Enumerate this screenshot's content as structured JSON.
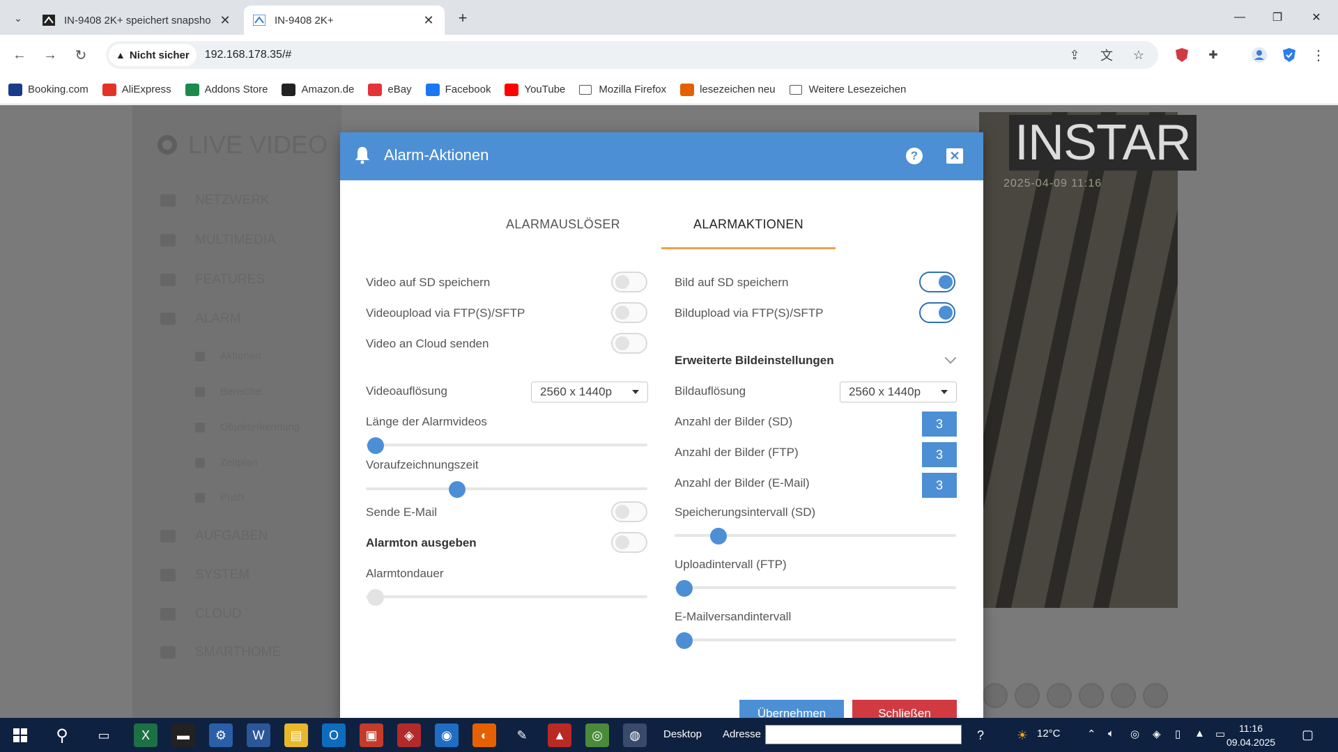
{
  "browser": {
    "tabs": [
      {
        "title": "IN-9408 2K+ speichert snapsho",
        "active": false
      },
      {
        "title": "IN-9408 2K+",
        "active": true
      }
    ],
    "security_label": "Nicht sicher",
    "url": "192.168.178.35/#",
    "bookmarks": [
      {
        "label": "Booking.com",
        "icon": "booking-icon",
        "color": "#1a3a8c"
      },
      {
        "label": "AliExpress",
        "icon": "aliexpress-icon",
        "color": "#e43225"
      },
      {
        "label": "Addons Store",
        "icon": "addons-icon",
        "color": "#1b8a4a"
      },
      {
        "label": "Amazon.de",
        "icon": "amazon-icon",
        "color": "#222222"
      },
      {
        "label": "eBay",
        "icon": "ebay-icon",
        "color": "#e53238"
      },
      {
        "label": "Facebook",
        "icon": "facebook-icon",
        "color": "#1877f2"
      },
      {
        "label": "YouTube",
        "icon": "youtube-icon",
        "color": "#ff0000"
      },
      {
        "label": "Mozilla Firefox",
        "icon": "folder-icon",
        "color": "#555555"
      },
      {
        "label": "lesezeichen neu",
        "icon": "firefox-icon",
        "color": "#e66000"
      },
      {
        "label": "Weitere Lesezeichen",
        "icon": "folder-icon",
        "color": "#555555"
      }
    ]
  },
  "background": {
    "sidebar_title": "LIVE VIDEO",
    "menu": [
      {
        "label": "NETZWERK"
      },
      {
        "label": "MULTIMEDIA"
      },
      {
        "label": "FEATURES"
      },
      {
        "label": "ALARM"
      },
      {
        "label": "AUFGABEN"
      },
      {
        "label": "SYSTEM"
      },
      {
        "label": "CLOUD"
      },
      {
        "label": "SMARTHOME"
      }
    ],
    "submenu": [
      {
        "label": "Aktionen"
      },
      {
        "label": "Bereiche"
      },
      {
        "label": "Objekterkennung"
      },
      {
        "label": "Zeitplan"
      },
      {
        "label": "Push"
      }
    ],
    "camera_logo": "INSTAR",
    "camera_timestamp": "2025-04-09 11:16"
  },
  "modal": {
    "title": "Alarm-Aktionen",
    "tabs": [
      {
        "label": "ALARMAUSLÖSER",
        "active": false
      },
      {
        "label": "ALARMAKTIONEN",
        "active": true
      }
    ],
    "left": {
      "video_sd": {
        "label": "Video auf SD speichern",
        "on": false
      },
      "video_ftp": {
        "label": "Videoupload via FTP(S)/SFTP",
        "on": false
      },
      "video_cloud": {
        "label": "Video an Cloud senden",
        "on": false
      },
      "video_resolution": {
        "label": "Videoauflösung",
        "value": "2560 x 1440p"
      },
      "alarm_video_length": {
        "label": "Länge der Alarmvideos",
        "level": 0.0
      },
      "prerecord_time": {
        "label": "Voraufzeichnungszeit",
        "level": 0.31
      },
      "send_email": {
        "label": "Sende E-Mail",
        "on": false
      },
      "alarm_tone": {
        "label": "Alarmton ausgeben",
        "on": false
      },
      "alarm_tone_duration": {
        "label": "Alarmtondauer",
        "level": 0.0
      }
    },
    "right": {
      "image_sd": {
        "label": "Bild auf SD speichern",
        "on": true
      },
      "image_ftp": {
        "label": "Bildupload via FTP(S)/SFTP",
        "on": true
      },
      "advanced_section": "Erweiterte Bildeinstellungen",
      "image_resolution": {
        "label": "Bildauflösung",
        "value": "2560 x 1440p"
      },
      "count_sd": {
        "label": "Anzahl der Bilder (SD)",
        "value": "3"
      },
      "count_ftp": {
        "label": "Anzahl der Bilder (FTP)",
        "value": "3"
      },
      "count_email": {
        "label": "Anzahl der Bilder (E-Mail)",
        "value": "3"
      },
      "interval_sd": {
        "label": "Speicherungsintervall (SD)",
        "level": 0.13
      },
      "interval_ftp": {
        "label": "Uploadintervall (FTP)",
        "level": 0.0
      },
      "interval_email": {
        "label": "E-Mailversandintervall",
        "level": 0.0
      }
    },
    "buttons": {
      "apply": "Übernehmen",
      "close": "Schließen"
    }
  },
  "taskbar": {
    "desktop_label": "Desktop",
    "address_label": "Adresse",
    "temperature": "12°C",
    "time": "11:16",
    "date": "09.04.2025"
  },
  "colors": {
    "accent": "#4d8fd4",
    "tab_underline": "#f0a048",
    "close_button": "#d23a42",
    "taskbar": "#0e2140"
  }
}
